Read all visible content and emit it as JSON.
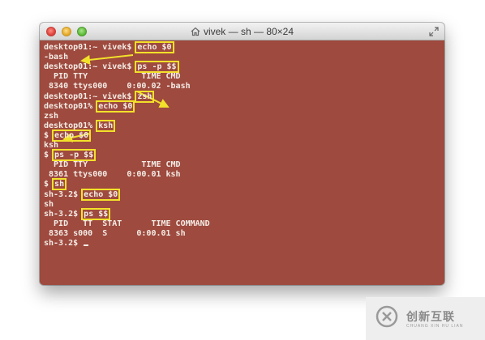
{
  "window": {
    "title": "vivek — sh — 80×24",
    "background_color": "#9e4a3e",
    "text_color": "#f4ece6",
    "highlight_color": "#f2e12a"
  },
  "terminal": {
    "lines": [
      {
        "prefix": "desktop01:~ vivek$ ",
        "cmd": "echo $0",
        "rest": ""
      },
      {
        "prefix": "-bash",
        "cmd": "",
        "rest": ""
      },
      {
        "prefix": "desktop01:~ vivek$ ",
        "cmd": "ps -p $$",
        "rest": ""
      },
      {
        "prefix": "  PID TTY           TIME CMD",
        "cmd": "",
        "rest": ""
      },
      {
        "prefix": " 8340 ttys000    0:00.02 -bash",
        "cmd": "",
        "rest": ""
      },
      {
        "prefix": "desktop01:~ vivek$ ",
        "cmd": "zsh",
        "rest": ""
      },
      {
        "prefix": "desktop01% ",
        "cmd": "echo $0",
        "rest": ""
      },
      {
        "prefix": "zsh",
        "cmd": "",
        "rest": ""
      },
      {
        "prefix": "desktop01% ",
        "cmd": "ksh",
        "rest": ""
      },
      {
        "prefix": "$ ",
        "cmd": "echo $0",
        "rest": ""
      },
      {
        "prefix": "ksh",
        "cmd": "",
        "rest": ""
      },
      {
        "prefix": "$ ",
        "cmd": "ps -p $$",
        "rest": ""
      },
      {
        "prefix": "  PID TTY           TIME CMD",
        "cmd": "",
        "rest": ""
      },
      {
        "prefix": " 8361 ttys000    0:00.01 ksh",
        "cmd": "",
        "rest": ""
      },
      {
        "prefix": "$ ",
        "cmd": "sh",
        "rest": ""
      },
      {
        "prefix": "sh-3.2$ ",
        "cmd": "echo $0",
        "rest": ""
      },
      {
        "prefix": "sh",
        "cmd": "",
        "rest": ""
      },
      {
        "prefix": "sh-3.2$ ",
        "cmd": "ps $$",
        "rest": ""
      },
      {
        "prefix": "  PID   TT  STAT      TIME COMMAND",
        "cmd": "",
        "rest": ""
      },
      {
        "prefix": " 8363 s000  S      0:00.01 sh",
        "cmd": "",
        "rest": ""
      },
      {
        "prefix": "sh-3.2$ ",
        "cmd": "",
        "rest": "",
        "cursor": true
      }
    ]
  },
  "watermark": {
    "brand": "创新互联",
    "brand_sub": "CHUANG XIN HU LIAN"
  },
  "icons": {
    "close": "close-button",
    "minimize": "minimize-button",
    "zoom": "zoom-button",
    "home": "home-icon",
    "fullscreen": "fullscreen-icon",
    "logo": "logo-icon"
  }
}
